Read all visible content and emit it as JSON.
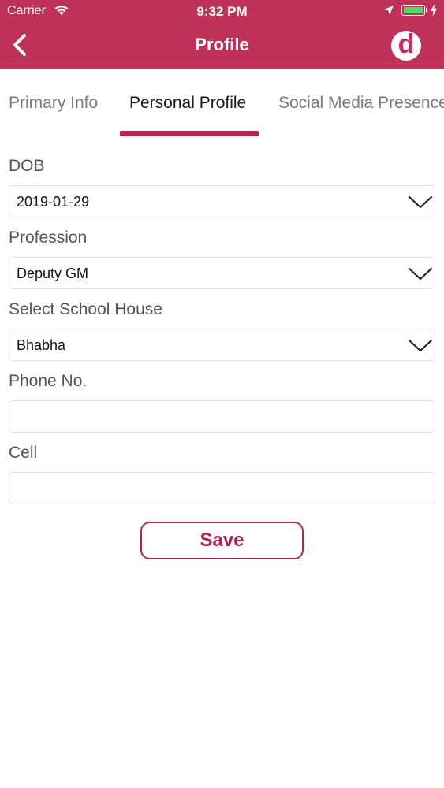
{
  "status_bar": {
    "carrier": "Carrier",
    "time": "9:32 PM"
  },
  "header": {
    "title": "Profile",
    "logo_letter": "d",
    "back_icon": "chevron-left-icon",
    "color": "#c0315a"
  },
  "tabs": [
    {
      "label": "Primary Info",
      "active": false
    },
    {
      "label": "Personal Profile",
      "active": true
    },
    {
      "label": "Social Media Presence",
      "active": false
    }
  ],
  "form": {
    "dob": {
      "label": "DOB",
      "value": "2019-01-29"
    },
    "profession": {
      "label": "Profession",
      "value": "Deputy GM"
    },
    "school_house": {
      "label": "Select School House",
      "value": "Bhabha"
    },
    "phone": {
      "label": "Phone No.",
      "value": ""
    },
    "cell": {
      "label": "Cell",
      "value": ""
    }
  },
  "save_label": "Save",
  "accent_color": "#b3244e"
}
